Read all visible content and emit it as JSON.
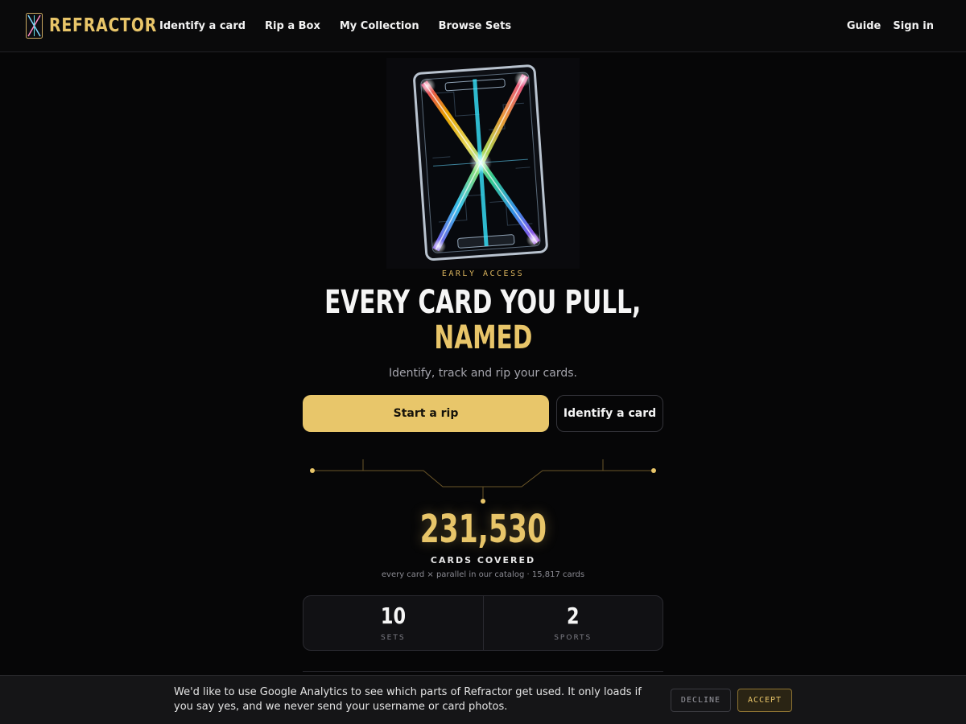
{
  "header": {
    "brand": "REFRACTOR",
    "nav": [
      "Identify a card",
      "Rip a Box",
      "My Collection",
      "Browse Sets"
    ],
    "right_nav": [
      "Guide",
      "Sign in"
    ]
  },
  "hero": {
    "eyebrow": "EARLY ACCESS",
    "headline_line1": "EVERY CARD YOU PULL,",
    "headline_line2": "NAMED",
    "subtitle": "Identify, track and rip your cards.",
    "primary_cta": "Start a rip",
    "secondary_cta": "Identify a card"
  },
  "coverage": {
    "count": "231,530",
    "label": "CARDS COVERED",
    "note": "every card × parallel in our catalog · 15,817 cards"
  },
  "stats": [
    {
      "value": "10",
      "label": "SETS"
    },
    {
      "value": "2",
      "label": "SPORTS"
    }
  ],
  "cookie_banner": {
    "text": "We'd like to use Google Analytics to see which parts of Refractor get used. It only loads if you say yes, and we never send your username or card photos.",
    "decline": "DECLINE",
    "accept": "ACCEPT"
  },
  "colors": {
    "accent": "#e8c569",
    "background": "#060607"
  }
}
